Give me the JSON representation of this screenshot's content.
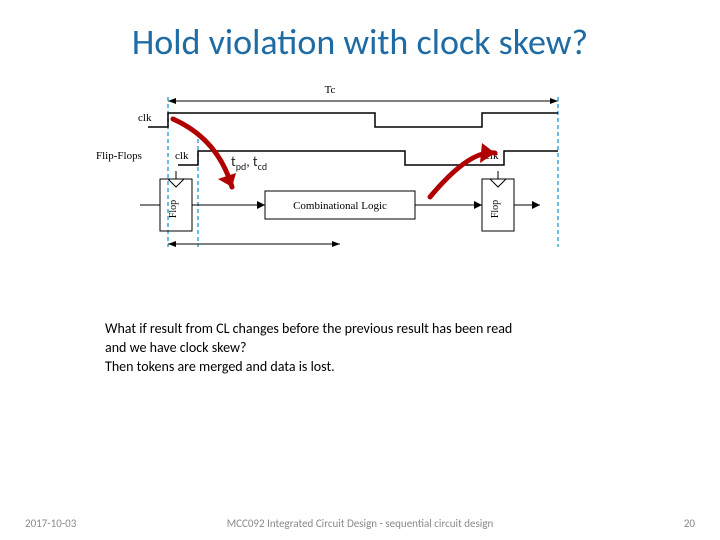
{
  "title": "Hold violation with clock skew?",
  "diagram": {
    "tc_label": "Tc",
    "clk_top": "clk",
    "clk_bot": "clk",
    "flipflops_label": "Flip-Flops",
    "flop1": "Flop",
    "flop2": "Flop",
    "combo": "Combinational Logic",
    "timing_label_t1": "t",
    "timing_label_t1_sub": "pd",
    "timing_label_sep": ", ",
    "timing_label_t2": "t",
    "timing_label_t2_sub": "cd"
  },
  "body": {
    "l1": "What if result from CL changes before the previous result has been read",
    "l2": "and we have clock skew?",
    "l3": "Then tokens are merged and data is lost."
  },
  "footer": {
    "date": "2017-10-03",
    "course": "MCC092 Integrated Circuit Design - sequential circuit design",
    "page": "20"
  }
}
